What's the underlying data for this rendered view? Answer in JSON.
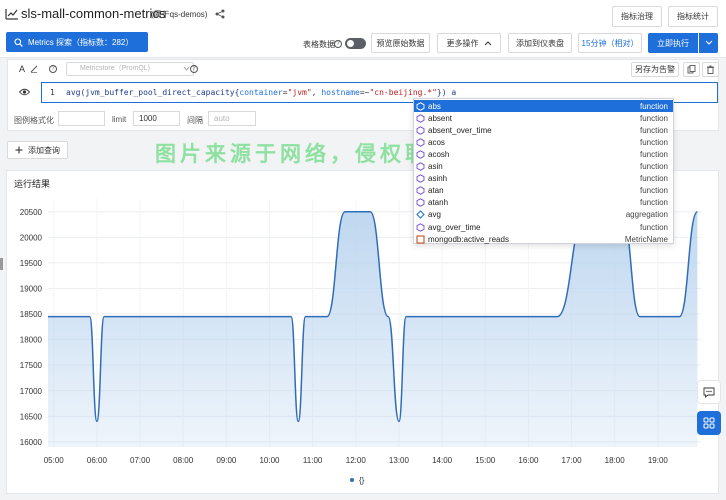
{
  "header": {
    "title": "sls-mall-common-metrics",
    "subtitle": "(属于qs-demos)",
    "btn_governance": "指标治理",
    "btn_stats": "指标统计"
  },
  "toolbar": {
    "metrics_explore": "Metrics 探索（指标数：282）",
    "table_data": "表格数据",
    "preview_raw": "预览原始数据",
    "more_ops": "更多操作",
    "add_dashboard": "添加到仪表盘",
    "time_range": "15分钟（相对）",
    "run_now": "立即执行"
  },
  "query": {
    "tool_a": "A",
    "store_placeholder": "Metricstore（PromQL)",
    "save_alert": "另存为告警",
    "line_number": "1",
    "code_fn": "avg(jvm_buffer_pool_direct_capacity{",
    "code_attr1": "container",
    "code_eq1": "=",
    "code_val1": "\"jvm\"",
    "code_comma": ", ",
    "code_attr2": "hostname",
    "code_eq2": "=~",
    "code_val2": "\"cn-beijing.*\"",
    "code_tail": "}) a",
    "legend_format_label": "图例格式化",
    "limit_label": "limit",
    "limit_value": "1000",
    "interval_label": "间隔",
    "interval_placeholder": "auto"
  },
  "add_query": "添加查询",
  "result_title": "运行结果",
  "watermark": "图片来源于网络，侵权联系站长删除！",
  "autocomplete": {
    "items": [
      {
        "name": "abs",
        "type": "function",
        "icon": "function-icon",
        "selected": true
      },
      {
        "name": "absent",
        "type": "function",
        "icon": "function-icon",
        "selected": false
      },
      {
        "name": "absent_over_time",
        "type": "function",
        "icon": "function-icon",
        "selected": false
      },
      {
        "name": "acos",
        "type": "function",
        "icon": "function-icon",
        "selected": false
      },
      {
        "name": "acosh",
        "type": "function",
        "icon": "function-icon",
        "selected": false
      },
      {
        "name": "asin",
        "type": "function",
        "icon": "function-icon",
        "selected": false
      },
      {
        "name": "asinh",
        "type": "function",
        "icon": "function-icon",
        "selected": false
      },
      {
        "name": "atan",
        "type": "function",
        "icon": "function-icon",
        "selected": false
      },
      {
        "name": "atanh",
        "type": "function",
        "icon": "function-icon",
        "selected": false
      },
      {
        "name": "avg",
        "type": "aggregation",
        "icon": "aggregation-icon",
        "selected": false
      },
      {
        "name": "avg_over_time",
        "type": "function",
        "icon": "function-icon",
        "selected": false
      },
      {
        "name": "mongodb:active_reads",
        "type": "MetricName",
        "icon": "metric-icon",
        "selected": false
      }
    ]
  },
  "colors": {
    "primary": "#1e6fd9",
    "line": "#2f6db8",
    "area": "#bcd5ef"
  },
  "chart_data": {
    "type": "area",
    "x_ticks": [
      "05:00",
      "06:00",
      "07:00",
      "08:00",
      "09:00",
      "10:00",
      "11:00",
      "12:00",
      "13:00",
      "14:00",
      "15:00",
      "16:00",
      "17:00",
      "18:00",
      "19:00"
    ],
    "y_ticks": [
      16000,
      16500,
      17000,
      17500,
      18000,
      18500,
      19000,
      19500,
      20000,
      20500
    ],
    "ylim": [
      15900,
      20750
    ],
    "xlim": [
      "04:52",
      "20:00"
    ],
    "legend": [
      "{}"
    ],
    "series": [
      {
        "name": "{}",
        "points": [
          [
            "04:52",
            18450
          ],
          [
            "05:50",
            18450
          ],
          [
            "06:00",
            16400
          ],
          [
            "06:10",
            18450
          ],
          [
            "09:45",
            18450
          ],
          [
            "10:30",
            18450
          ],
          [
            "10:40",
            16400
          ],
          [
            "10:50",
            18450
          ],
          [
            "11:20",
            18450
          ],
          [
            "11:45",
            20500
          ],
          [
            "12:20",
            20500
          ],
          [
            "12:45",
            18450
          ],
          [
            "13:00",
            16400
          ],
          [
            "13:10",
            18450
          ],
          [
            "16:40",
            18450
          ],
          [
            "17:20",
            20500
          ],
          [
            "18:10",
            20500
          ],
          [
            "18:35",
            18450
          ],
          [
            "19:30",
            18450
          ],
          [
            "19:55",
            20500
          ]
        ]
      }
    ]
  }
}
